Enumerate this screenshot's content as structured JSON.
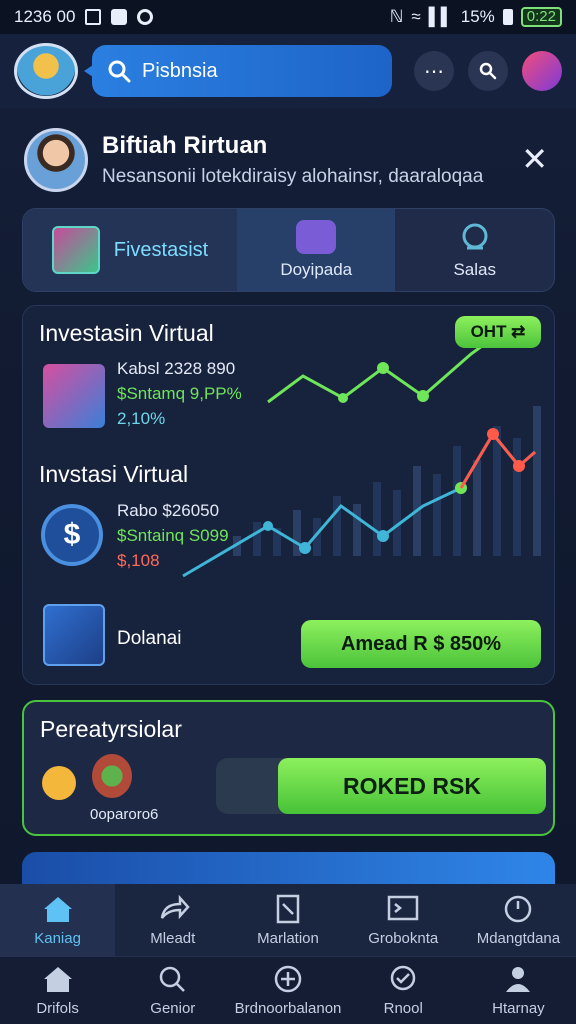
{
  "status_bar": {
    "time": "1236 00",
    "battery_pct": "15%",
    "battery_label": "0:22"
  },
  "search": {
    "placeholder": "Pisbnsia"
  },
  "profile": {
    "name": "Biftiah Rirtuan",
    "subtitle": "Nesansonii lotekdiraisy alohainsr, daaraloqaa"
  },
  "tabs": [
    {
      "label": "Fivestasist"
    },
    {
      "label": "Doyipada"
    },
    {
      "label": "Salas"
    }
  ],
  "investments": {
    "block1": {
      "title": "Investasin Virtual",
      "line1": "Kabsl 2328 890",
      "line2": "$Sntamq 9,PP%",
      "line3": "2,10%",
      "badge": "OHT ⇄"
    },
    "block2": {
      "title": "Invstasi Virtual",
      "line1": "Rabo $26050",
      "line2": "$Sntainq S099",
      "line3": "$,108"
    },
    "block3": {
      "label": "Dolanai",
      "button": "Amead R $ 850%"
    }
  },
  "promo": {
    "title": "Pereatyrsiolar",
    "subtitle": "0oparoro6",
    "button": "ROKED RSK"
  },
  "nav_primary": [
    {
      "label": "Kaniag",
      "icon": "home-icon"
    },
    {
      "label": "Mleadt",
      "icon": "share-arrow-icon"
    },
    {
      "label": "Marlation",
      "icon": "document-icon"
    },
    {
      "label": "Groboknta",
      "icon": "terminal-icon"
    },
    {
      "label": "Mdangtdana",
      "icon": "clock-icon"
    }
  ],
  "nav_secondary": [
    {
      "label": "Drifols",
      "icon": "home-icon"
    },
    {
      "label": "Genior",
      "icon": "search-icon"
    },
    {
      "label": "Brdnoorbalanon",
      "icon": "plus-circle-icon"
    },
    {
      "label": "Rnool",
      "icon": "chat-icon"
    },
    {
      "label": "Htarnay",
      "icon": "person-icon"
    }
  ],
  "colors": {
    "accent_green": "#6fe55a",
    "accent_blue": "#2a7fe0",
    "accent_red": "#ff6a5a",
    "line_cyan": "#3fb6d8"
  }
}
